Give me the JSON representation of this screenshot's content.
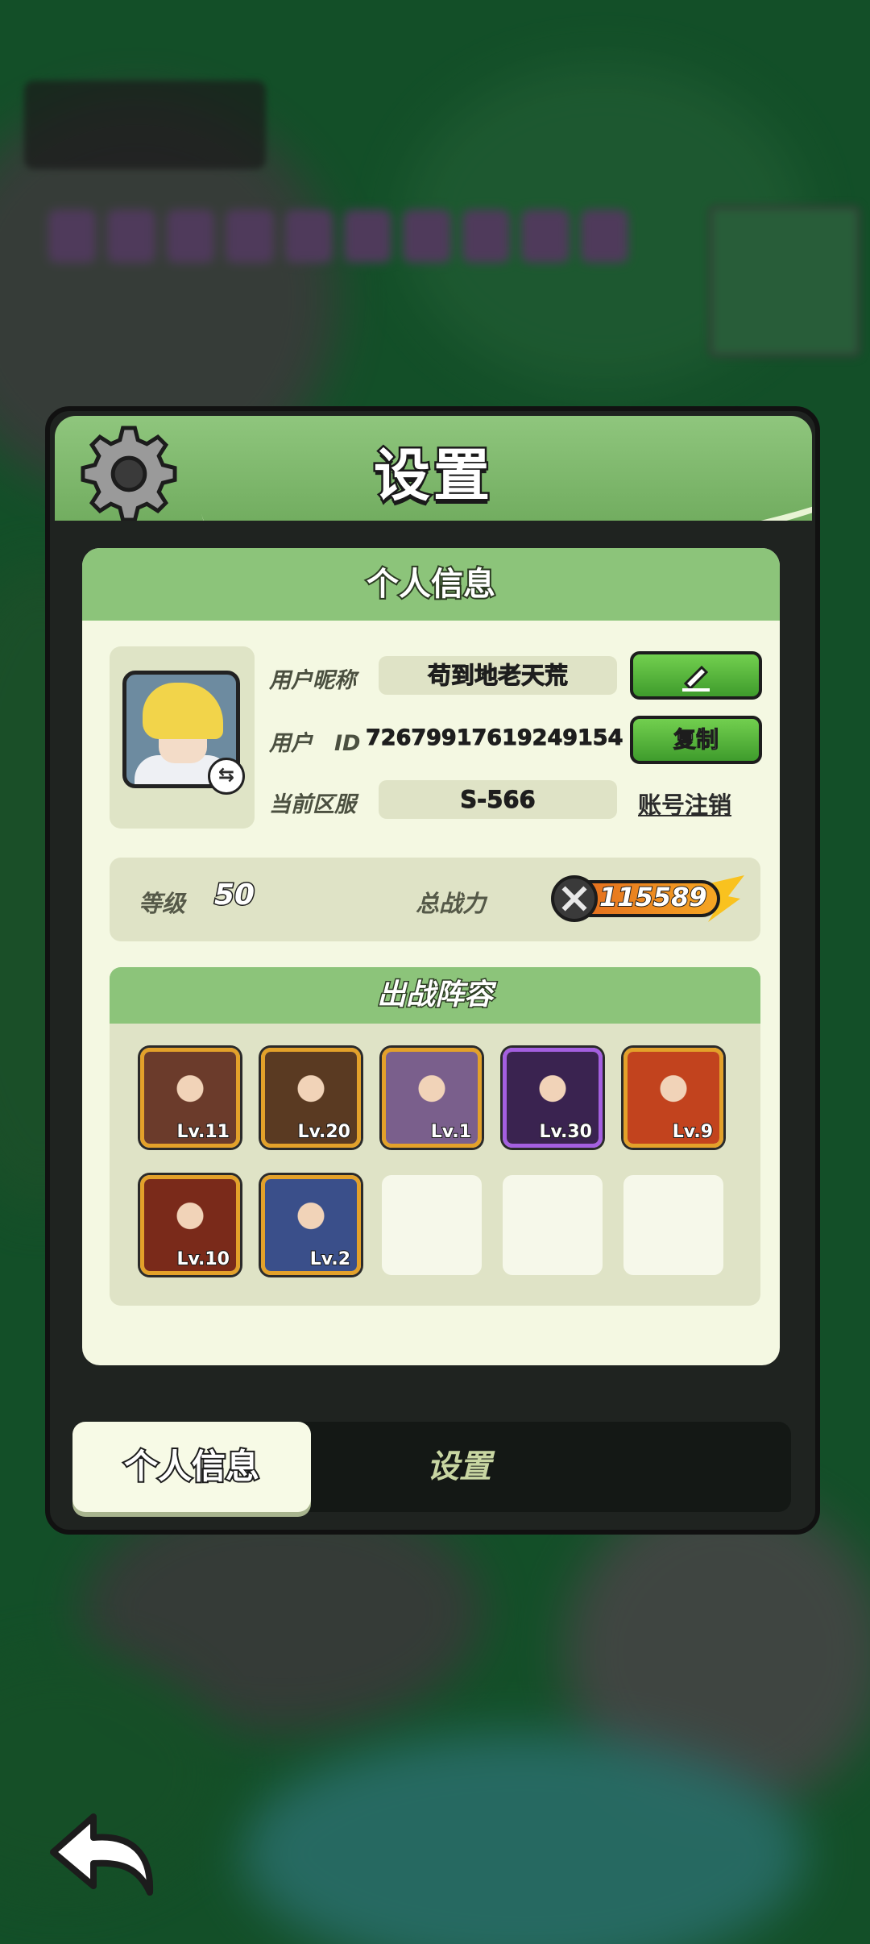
{
  "window": {
    "title": "设置"
  },
  "personal_info": {
    "header": "个人信息",
    "nickname_label": "用户昵称",
    "nickname": "苟到地老天荒",
    "id_label": "用户　ID",
    "user_id": "72679917619249154",
    "copy_button": "复制",
    "server_label": "当前区服",
    "server": "S-566",
    "deregister_link": "账号注销",
    "level_label": "等级",
    "level": "50",
    "power_label": "总战力",
    "power": "115589"
  },
  "lineup": {
    "header": "出战阵容",
    "heroes": [
      {
        "level": "Lv.11",
        "color": "#6b3b2b",
        "frame": "gold"
      },
      {
        "level": "Lv.20",
        "color": "#5a3a22",
        "frame": "gold"
      },
      {
        "level": "Lv.1",
        "color": "#7a5f8c",
        "frame": "gold"
      },
      {
        "level": "Lv.30",
        "color": "#3a2350",
        "frame": "purple"
      },
      {
        "level": "Lv.9",
        "color": "#c2431e",
        "frame": "gold"
      },
      {
        "level": "Lv.10",
        "color": "#7a2a1a",
        "frame": "gold"
      },
      {
        "level": "Lv.2",
        "color": "#3a4f8a",
        "frame": "gold"
      }
    ],
    "empty_slots": 3
  },
  "tabs": {
    "active": "个人信息",
    "inactive": "设置"
  },
  "icons": {
    "gear": "gear-icon",
    "edit": "pencil-icon",
    "back": "back-arrow-icon",
    "power": "crossed-swords-icon"
  }
}
